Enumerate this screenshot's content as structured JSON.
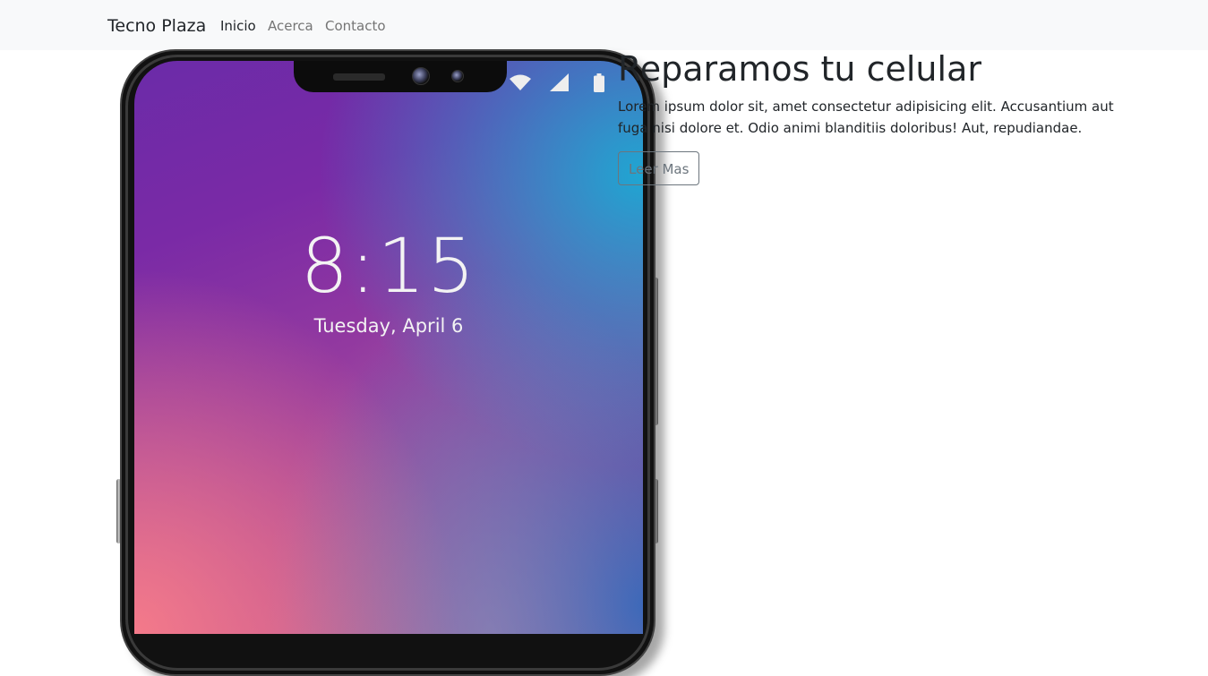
{
  "navbar": {
    "brand": "Tecno Plaza",
    "links": [
      {
        "label": "Inicio",
        "active": true
      },
      {
        "label": "Acerca",
        "active": false
      },
      {
        "label": "Contacto",
        "active": false
      }
    ]
  },
  "phone": {
    "time": "8:15",
    "date": "Tuesday, April 6",
    "status_icons": [
      "wifi-icon",
      "signal-icon",
      "battery-icon"
    ]
  },
  "hero": {
    "title": "Reparamos tu celular",
    "text": "Lorem ipsum dolor sit, amet consectetur adipisicing elit. Accusantium aut fuga nisi dolore et. Odio animi blanditiis doloribus! Aut, repudiandae.",
    "button_label": "Leer Mas"
  },
  "colors": {
    "navbar_bg": "#f8f9fa",
    "text_dark": "#212529",
    "text_muted": "#757575",
    "button_outline": "#6c757d"
  }
}
